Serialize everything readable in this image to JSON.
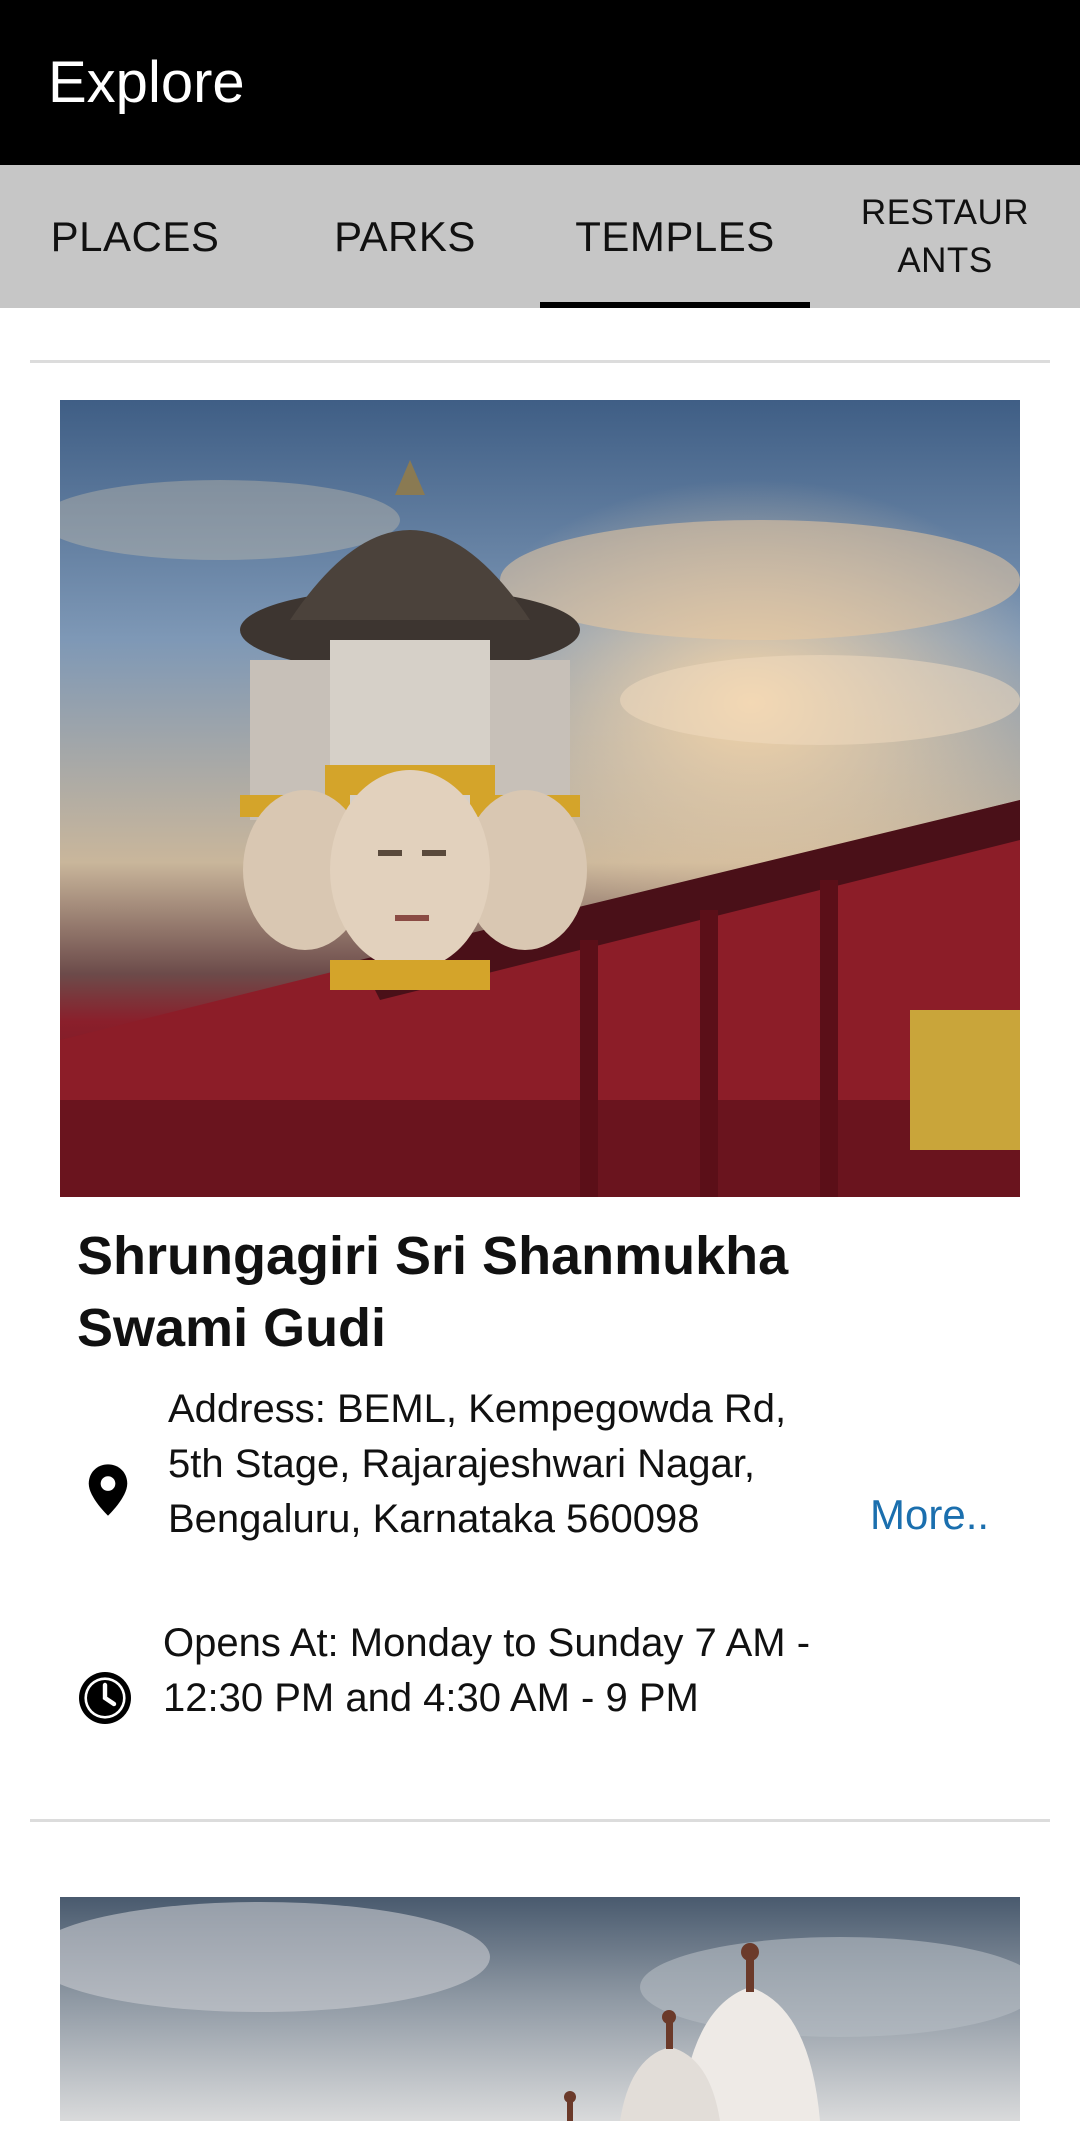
{
  "appbar": {
    "title": "Explore"
  },
  "tabs": [
    {
      "label": "PLACES",
      "active": false
    },
    {
      "label": "PARKS",
      "active": false
    },
    {
      "label": "TEMPLES",
      "active": true
    },
    {
      "label": "RESTAURANTS",
      "active": false
    }
  ],
  "cards": [
    {
      "title": "Shrungagiri Sri Shanmukha Swami Gudi",
      "address": "Address: BEML, Kempegowda Rd, 5th Stage, Rajarajeshwari Nagar, Bengaluru, Karnataka 560098",
      "hours": "Opens At: Monday to Sunday 7 AM - 12:30 PM and 4:30 AM - 9 PM",
      "more_label": "More..",
      "address_icon": "location-pin-icon",
      "hours_icon": "clock-icon"
    }
  ],
  "colors": {
    "appbar_bg": "#000000",
    "tabbar_bg": "#c6c6c6",
    "link": "#1b6fae"
  }
}
